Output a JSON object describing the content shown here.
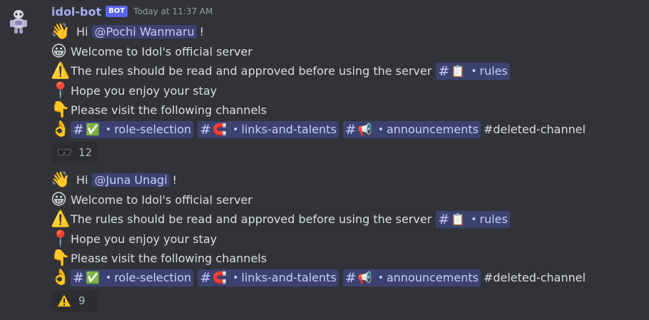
{
  "message": {
    "username": "idol-bot",
    "bot_tag": "BOT",
    "timestamp": "Today at 11:37 AM"
  },
  "blocks": [
    {
      "greeting": "Hi",
      "mention": "@Pochi Wanmaru",
      "greeting_end": "!",
      "welcome": "Welcome to Idol's official server",
      "rules_text": "The rules should be read and approved before using the server",
      "rules_channel": "rules",
      "enjoy": "Hope you enjoy your stay",
      "visit": "Please visit the following channels",
      "channels": [
        "role-selection",
        "links-and-talents",
        "announcements"
      ],
      "deleted_channel": "#deleted-channel",
      "reaction_count": "12",
      "reaction_icon": "sunglasses-icon"
    },
    {
      "greeting": "Hi",
      "mention": "@Juna Unagi",
      "greeting_end": "!",
      "welcome": "Welcome to Idol's official server",
      "rules_text": "The rules should be read and approved before using the server",
      "rules_channel": "rules",
      "enjoy": "Hope you enjoy your stay",
      "visit": "Please visit the following channels",
      "channels": [
        "role-selection",
        "links-and-talents",
        "announcements"
      ],
      "deleted_channel": "#deleted-channel",
      "reaction_count": "9",
      "reaction_icon": "warning-icon"
    }
  ],
  "channel_dot": "•",
  "hash": "#",
  "colors": {
    "background": "#313338",
    "username": "#a7b0f8",
    "bot_tag": "#5865f2",
    "mention_bg": "#3c4270",
    "mention_text": "#c9cdfb",
    "text": "#dbdee1",
    "reaction_bg": "#2b2d31"
  }
}
